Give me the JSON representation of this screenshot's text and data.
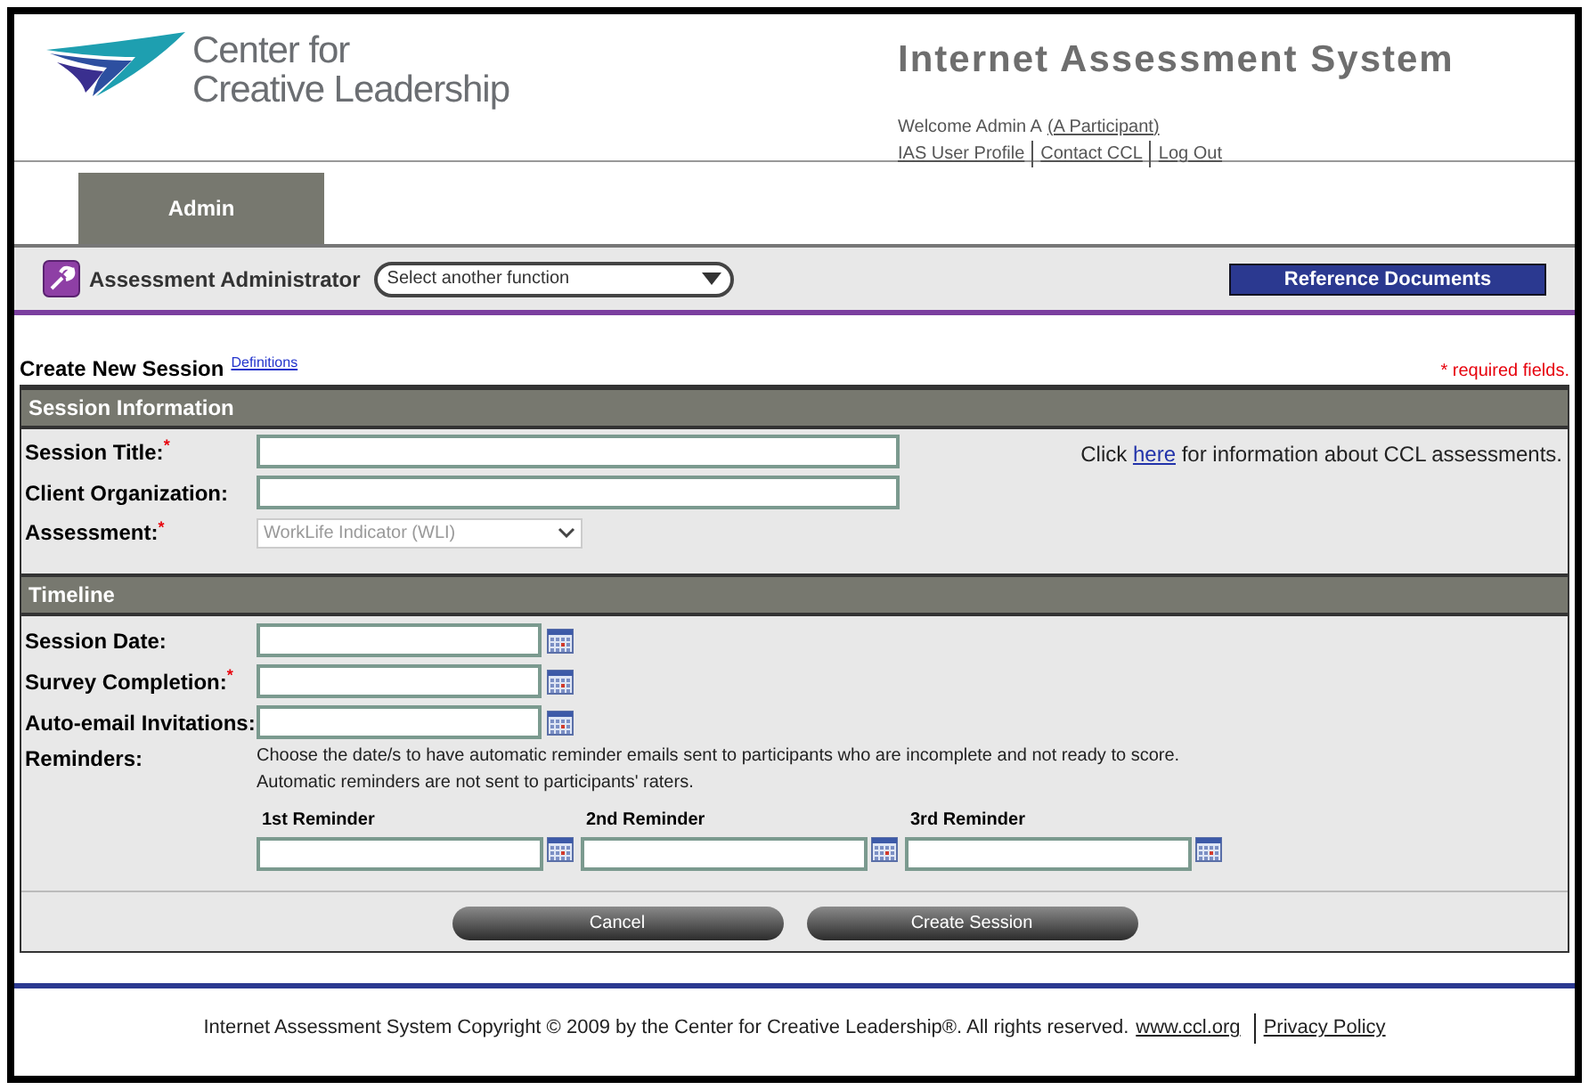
{
  "header": {
    "logo_lines": [
      "Center for",
      "Creative Leadership"
    ],
    "title": "Internet Assessment System",
    "welcome": "Welcome Admin A",
    "user_link": "(A Participant)",
    "links": [
      "IAS User Profile",
      "Contact CCL",
      "Log Out"
    ]
  },
  "tabs": [
    {
      "label": "Admin",
      "selected": true
    }
  ],
  "function_bar": {
    "label": "Assessment Administrator",
    "select_placeholder": "Select another function",
    "reference_button": "Reference Documents"
  },
  "page": {
    "title": "Create New Session",
    "definitions_link": "Definitions",
    "required_note": "* required fields."
  },
  "session_information": {
    "heading": "Session Information",
    "fields": [
      {
        "kind": "text",
        "label": "Session Title:$^{*}$"
      },
      {
        "kind": "text",
        "label": "Client Organization:"
      },
      {
        "kind": "select",
        "label": "Assessment:$^{*}$",
        "value": "WorkLife Indicator (WLI)",
        "disabled": true
      }
    ],
    "info_before": "Click",
    "info_link": "here",
    "info_after": "for information about CCL assessments."
  },
  "timeline": {
    "heading": "Timeline",
    "fields": [
      {
        "label": "Session Date:"
      },
      {
        "label": "Survey Completion:$^{*}$"
      },
      {
        "label": "Auto-email Invitations:"
      }
    ],
    "reminders_label": "Reminders:",
    "reminders_help": [
      "Choose the date/s to have automatic reminder emails sent to participants who are incomplete and not ready to score.",
      "Automatic reminders are not sent to participants' raters."
    ],
    "reminders": [
      "1st Reminder",
      "2nd Reminder",
      "3rd Reminder"
    ]
  },
  "buttons": [
    "Cancel",
    "Create Session"
  ],
  "footer": {
    "text": "Internet Assessment System Copyright © 2009 by the Center for Creative Leadership®. All rights reserved.",
    "links": [
      "www.ccl.org",
      "Privacy Policy"
    ]
  }
}
